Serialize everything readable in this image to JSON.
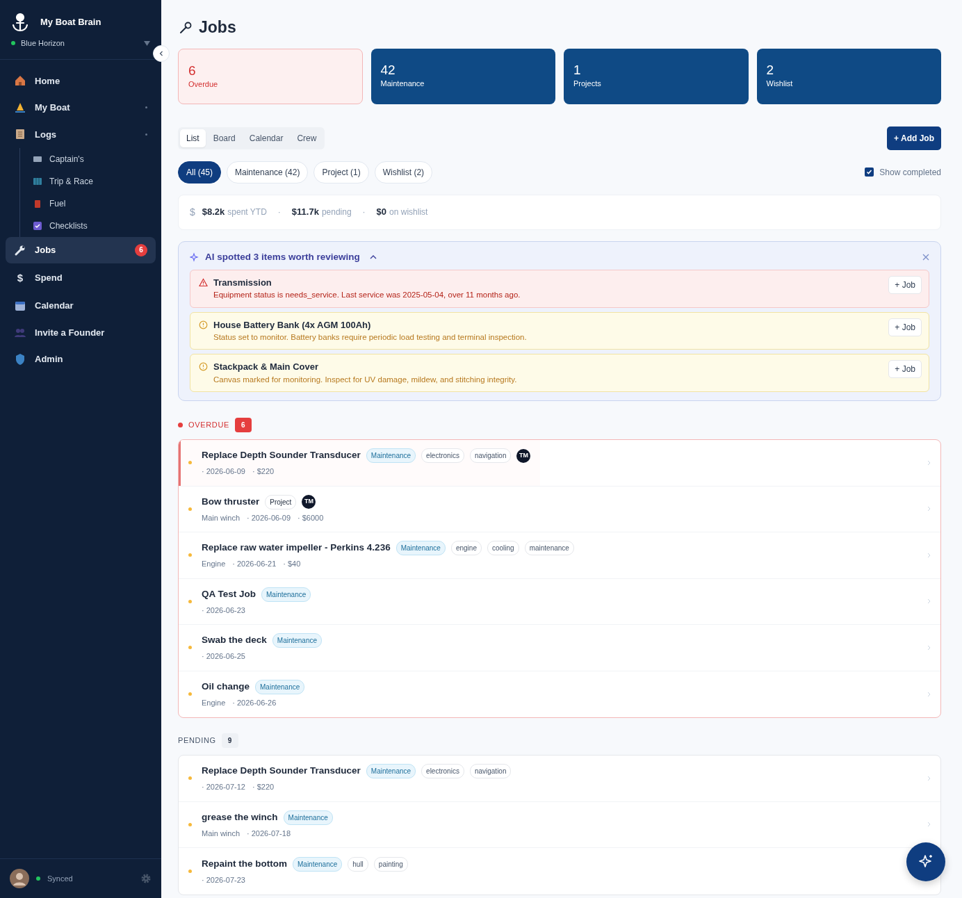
{
  "sidebar": {
    "app_name": "My Boat Brain",
    "boat": "Blue Horizon",
    "nav": [
      {
        "label": "Home",
        "kind": "item",
        "selected": false
      },
      {
        "label": "My Boat",
        "kind": "item",
        "selected": false,
        "expandable": true
      },
      {
        "label": "Logs",
        "kind": "item",
        "selected": false,
        "expandable": true
      },
      {
        "label": "Captain's",
        "kind": "sub",
        "selected": false
      },
      {
        "label": "Trip & Race",
        "kind": "sub",
        "selected": false
      },
      {
        "label": "Fuel",
        "kind": "sub",
        "selected": false
      },
      {
        "label": "Checklists",
        "kind": "sub",
        "selected": false
      },
      {
        "label": "Jobs",
        "kind": "item",
        "selected": true,
        "badge": "6"
      },
      {
        "label": "Spend",
        "kind": "item",
        "selected": false,
        "glyph": "$"
      },
      {
        "label": "Calendar",
        "kind": "item",
        "selected": false
      },
      {
        "label": "Invite a Founder",
        "kind": "item",
        "selected": false
      },
      {
        "label": "Admin",
        "kind": "item",
        "selected": false
      }
    ],
    "sync_status": "Synced"
  },
  "page_title": "Jobs",
  "stats": [
    {
      "value": "6",
      "label": "Overdue",
      "kind": "alert"
    },
    {
      "value": "42",
      "label": "Maintenance",
      "kind": "normal"
    },
    {
      "value": "1",
      "label": "Projects",
      "kind": "normal"
    },
    {
      "value": "2",
      "label": "Wishlist",
      "kind": "normal"
    }
  ],
  "view_tabs": [
    {
      "label": "List",
      "selected": true
    },
    {
      "label": "Board",
      "selected": false
    },
    {
      "label": "Calendar",
      "selected": false
    },
    {
      "label": "Crew",
      "selected": false
    }
  ],
  "add_button": "+ Add Job",
  "filters": [
    {
      "label": "All (45)",
      "selected": true
    },
    {
      "label": "Maintenance (42)",
      "selected": false
    },
    {
      "label": "Project (1)",
      "selected": false
    },
    {
      "label": "Wishlist (2)",
      "selected": false
    }
  ],
  "show_completed": {
    "label": "Show completed",
    "checked": true
  },
  "spend": {
    "symbol": "$",
    "separator": "·",
    "items": [
      {
        "amount": "$8.2k",
        "label": "spent YTD"
      },
      {
        "amount": "$11.7k",
        "label": "pending"
      },
      {
        "amount": "$0",
        "label": "on wishlist"
      }
    ]
  },
  "ai_panel": {
    "title": "AI spotted 3 items worth reviewing",
    "expanded": true,
    "items": [
      {
        "kind": "error",
        "title": "Transmission",
        "text": "Equipment status is needs_service. Last service was 2025-05-04, over 11 months ago.",
        "button": "+ Job"
      },
      {
        "kind": "warning",
        "title": "House Battery Bank (4x AGM 100Ah)",
        "text": "Status set to monitor. Battery banks require periodic load testing and terminal inspection.",
        "button": "+ Job"
      },
      {
        "kind": "warning",
        "title": "Stackpack & Main Cover",
        "text": "Canvas marked for monitoring. Inspect for UV damage, mildew, and stitching integrity.",
        "button": "+ Job"
      }
    ]
  },
  "groups": [
    {
      "title": "OVERDUE",
      "count": "6",
      "kind": "overdue",
      "jobs": [
        {
          "title": "Replace Depth Sounder Transducer",
          "type": {
            "label": "Maintenance",
            "kind": "maintenance"
          },
          "tags": [
            "electronics",
            "navigation"
          ],
          "assignee": "TM",
          "meta": [
            "· 2026-06-09",
            "· $220"
          ],
          "highlighted": true
        },
        {
          "title": "Bow thruster",
          "type": {
            "label": "Project",
            "kind": "project"
          },
          "assignee": "TM",
          "meta": [
            "Main winch",
            "· 2026-06-09",
            "· $6000"
          ],
          "highlighted": false
        },
        {
          "title": "Replace raw water impeller - Perkins 4.236",
          "type": {
            "label": "Maintenance",
            "kind": "maintenance"
          },
          "tags": [
            "engine",
            "cooling",
            "maintenance"
          ],
          "meta": [
            "Engine",
            "· 2026-06-21",
            "· $40"
          ],
          "highlighted": false
        },
        {
          "title": "QA Test Job",
          "type": {
            "label": "Maintenance",
            "kind": "maintenance"
          },
          "meta": [
            "· 2026-06-23"
          ],
          "highlighted": false
        },
        {
          "title": "Swab the deck",
          "type": {
            "label": "Maintenance",
            "kind": "maintenance"
          },
          "meta": [
            "· 2026-06-25"
          ],
          "highlighted": false
        },
        {
          "title": "Oil change",
          "type": {
            "label": "Maintenance",
            "kind": "maintenance"
          },
          "meta": [
            "Engine",
            "· 2026-06-26"
          ],
          "highlighted": false
        }
      ]
    },
    {
      "title": "PENDING",
      "count": "9",
      "kind": "pending",
      "jobs": [
        {
          "title": "Replace Depth Sounder Transducer",
          "type": {
            "label": "Maintenance",
            "kind": "maintenance"
          },
          "tags": [
            "electronics",
            "navigation"
          ],
          "meta": [
            "· 2026-07-12",
            "· $220"
          ],
          "highlighted": false
        },
        {
          "title": "grease the winch",
          "type": {
            "label": "Maintenance",
            "kind": "maintenance"
          },
          "meta": [
            "Main winch",
            "· 2026-07-18"
          ],
          "highlighted": false
        },
        {
          "title": "Repaint the bottom",
          "type": {
            "label": "Maintenance",
            "kind": "maintenance"
          },
          "tags": [
            "hull",
            "painting"
          ],
          "meta": [
            "· 2026-07-23"
          ],
          "highlighted": false
        }
      ]
    }
  ]
}
